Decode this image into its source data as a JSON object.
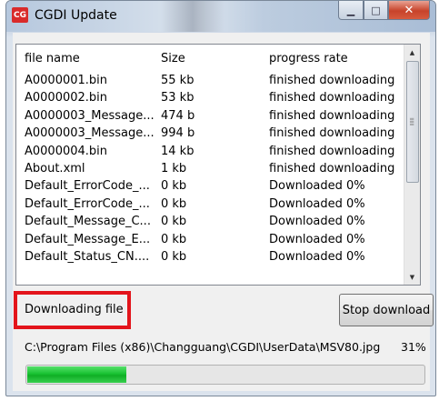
{
  "window": {
    "title": "CGDI Update",
    "app_icon_text": "CG",
    "controls": {
      "minimize": "▁",
      "maximize": "□",
      "close": "✕"
    }
  },
  "file_list": {
    "columns": [
      "file name",
      "Size",
      "progress rate"
    ],
    "rows": [
      [
        "A0000001.bin",
        "55 kb",
        "finished downloading"
      ],
      [
        "A0000002.bin",
        "53 kb",
        "finished downloading"
      ],
      [
        "A0000003_Message...",
        "474 b",
        "finished downloading"
      ],
      [
        "A0000003_Message...",
        "994 b",
        "finished downloading"
      ],
      [
        "A0000004.bin",
        "14 kb",
        "finished downloading"
      ],
      [
        "About.xml",
        "1 kb",
        "finished downloading"
      ],
      [
        "Default_ErrorCode_...",
        "0 kb",
        "Downloaded 0%"
      ],
      [
        "Default_ErrorCode_...",
        "0 kb",
        "Downloaded 0%"
      ],
      [
        "Default_Message_C...",
        "0 kb",
        "Downloaded 0%"
      ],
      [
        "Default_Message_E...",
        "0 kb",
        "Downloaded 0%"
      ],
      [
        "Default_Status_CN....",
        "0 kb",
        "Downloaded 0%"
      ]
    ]
  },
  "status": {
    "label": "Downloading file",
    "highlight_color": "#e3141b"
  },
  "stop_button_label": "Stop download",
  "current_file_path": "C:\\Program Files (x86)\\Changguang\\CGDI\\UserData\\MSV80.jpg",
  "progress": {
    "percent_text": "31%",
    "value": 0.25,
    "fill_color": "#18c232"
  }
}
